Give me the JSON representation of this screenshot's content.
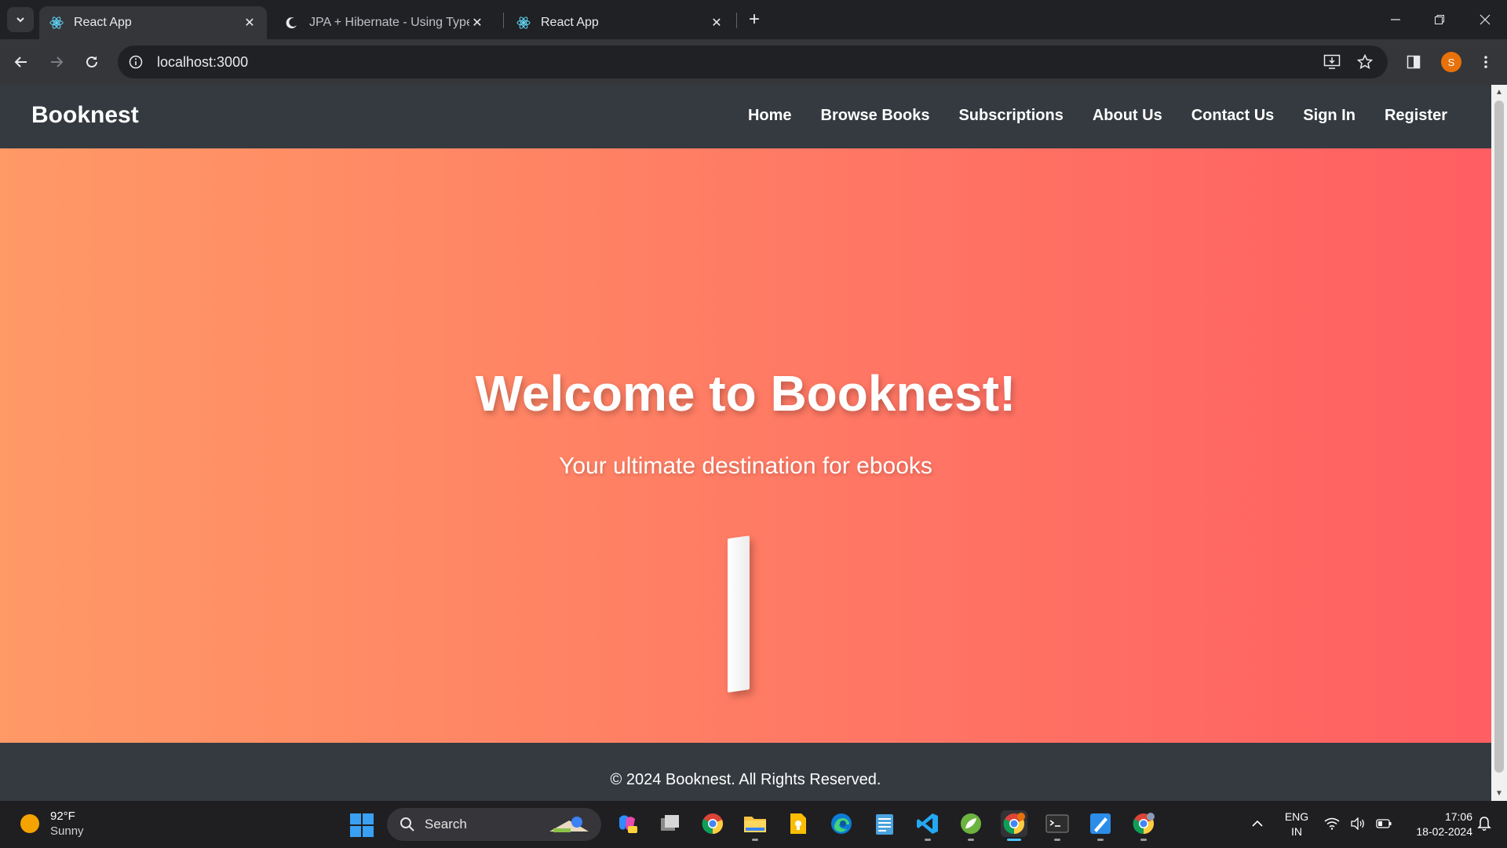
{
  "browser": {
    "tabs": [
      {
        "title": "React App",
        "active": true
      },
      {
        "title": "JPA + Hibernate - Using TypedQ",
        "active": false
      },
      {
        "title": "React App",
        "active": false
      }
    ],
    "url": "localhost:3000",
    "profile_initial": "S"
  },
  "site": {
    "brand": "Booknest",
    "nav": [
      "Home",
      "Browse Books",
      "Subscriptions",
      "About Us",
      "Contact Us",
      "Sign In",
      "Register"
    ],
    "hero_title": "Welcome to Booknest!",
    "hero_subtitle": "Your ultimate destination for ebooks",
    "footer": "© 2024 Booknest. All Rights Reserved.",
    "colors": {
      "nav_bg": "#343a40",
      "hero_gradient_start": "#ff9966",
      "hero_gradient_end": "#ff5e62"
    }
  },
  "taskbar": {
    "weather_temp": "92°F",
    "weather_desc": "Sunny",
    "search_label": "Search",
    "language": "ENG",
    "region": "IN",
    "time": "17:06",
    "date": "18-02-2024",
    "apps": [
      "copilot-icon",
      "task-view-icon",
      "chrome-icon",
      "file-explorer-icon",
      "keep-icon",
      "edge-icon",
      "notepad-icon",
      "vscode-icon",
      "spring-icon",
      "chrome-profile-icon",
      "terminal-icon",
      "paint-icon",
      "chrome-profile-p-icon"
    ]
  }
}
